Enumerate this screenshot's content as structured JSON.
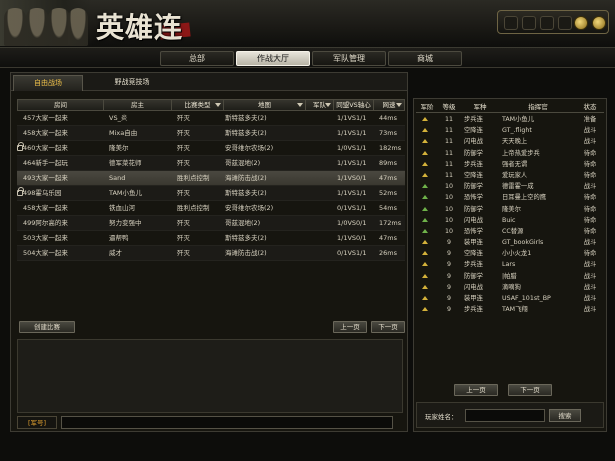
{
  "app": {
    "logo_text": "英雄连"
  },
  "nav": {
    "tabs": [
      {
        "label": "总部",
        "active": false
      },
      {
        "label": "作战大厅",
        "active": true
      },
      {
        "label": "军队管理",
        "active": false
      },
      {
        "label": "商城",
        "active": false
      }
    ]
  },
  "lobby": {
    "subtabs": [
      {
        "label": "自由战场",
        "active": true
      },
      {
        "label": "野战竞技场",
        "active": false
      }
    ],
    "columns": [
      "房间",
      "房主",
      "比赛类型",
      "地图",
      "军队",
      "同盟VS轴心",
      "网速"
    ],
    "rooms": [
      {
        "locked": false,
        "room": "457大家一起来",
        "host": "VS_炎",
        "type": "歼灭",
        "map": "斯特兹多夫(2)",
        "vs": "1/1VS1/1",
        "ping": "44ms"
      },
      {
        "locked": false,
        "room": "458大家一起来",
        "host": "Mixa自由",
        "type": "歼灭",
        "map": "斯特兹多夫(2)",
        "vs": "1/1VS1/1",
        "ping": "73ms"
      },
      {
        "locked": true,
        "room": "460大家一起来",
        "host": "隆美尔",
        "type": "歼灭",
        "map": "安哥维尔农场(2)",
        "vs": "1/0VS1/1",
        "ping": "182ms"
      },
      {
        "locked": false,
        "room": "464新手一起玩",
        "host": "德军菜花师",
        "type": "歼灭",
        "map": "哥兹混地(2)",
        "vs": "1/1VS1/1",
        "ping": "89ms"
      },
      {
        "locked": false,
        "room": "493大家一起来",
        "host": "Sand",
        "type": "胜利点控制",
        "map": "海滩防击战(2)",
        "vs": "1/1VS0/1",
        "ping": "47ms",
        "selected": true
      },
      {
        "locked": true,
        "room": "498霍乌乐园",
        "host": "TAM小鱼儿",
        "type": "歼灭",
        "map": "斯特兹多夫(2)",
        "vs": "1/1VS1/1",
        "ping": "52ms"
      },
      {
        "locked": false,
        "room": "458大家一起来",
        "host": "铁血山河",
        "type": "胜利点控制",
        "map": "安哥维尔农场(2)",
        "vs": "0/1VS1/1",
        "ping": "54ms"
      },
      {
        "locked": false,
        "room": "499阿尔高的来",
        "host": "努力变强中",
        "type": "歼灭",
        "map": "哥兹混地(2)",
        "vs": "1/0VS0/1",
        "ping": "172ms"
      },
      {
        "locked": false,
        "room": "503大家一起来",
        "host": "逼帮鸭",
        "type": "歼灭",
        "map": "斯特兹多夫(2)",
        "vs": "1/1VS0/1",
        "ping": "47ms"
      },
      {
        "locked": false,
        "room": "504大家一起来",
        "host": "威才",
        "type": "歼灭",
        "map": "海滩防击战(2)",
        "vs": "0/1VS1/1",
        "ping": "26ms"
      }
    ],
    "create_button": "创建比赛",
    "prev_button": "上一页",
    "next_button": "下一页",
    "chat_channel": "[军号]"
  },
  "players": {
    "columns": [
      "军阶",
      "等级",
      "军种",
      "指挥官",
      "状态"
    ],
    "rows": [
      {
        "rank": "gold",
        "level": "11",
        "branch": "步兵连",
        "name": "TAM小鱼儿",
        "status": "准备"
      },
      {
        "rank": "gold",
        "level": "11",
        "branch": "空降连",
        "name": "GT_.flight",
        "status": "战斗"
      },
      {
        "rank": "gold",
        "level": "11",
        "branch": "闪电战",
        "name": "天天晚上",
        "status": "战斗"
      },
      {
        "rank": "gold",
        "level": "11",
        "branch": "防御学",
        "name": "上帝热爱步兵",
        "status": "待命"
      },
      {
        "rank": "gold",
        "level": "11",
        "branch": "步兵连",
        "name": "强者无谓",
        "status": "待命"
      },
      {
        "rank": "gold",
        "level": "11",
        "branch": "空降连",
        "name": "爱玩家人",
        "status": "待命"
      },
      {
        "rank": "green",
        "level": "10",
        "branch": "防御学",
        "name": "德雷霍一成",
        "status": "战斗"
      },
      {
        "rank": "green",
        "level": "10",
        "branch": "恐怖学",
        "name": "日耳曼上空的鹰",
        "status": "待命"
      },
      {
        "rank": "green",
        "level": "10",
        "branch": "防御学",
        "name": "隆美尔",
        "status": "待命"
      },
      {
        "rank": "green",
        "level": "10",
        "branch": "闪电战",
        "name": "Buic",
        "status": "待命"
      },
      {
        "rank": "green",
        "level": "10",
        "branch": "恐怖学",
        "name": "CC替源",
        "status": "待命"
      },
      {
        "rank": "gold",
        "level": "9",
        "branch": "装甲连",
        "name": "GT_bookGirls",
        "status": "战斗"
      },
      {
        "rank": "gold",
        "level": "9",
        "branch": "空降连",
        "name": "小小火龙1",
        "status": "待命"
      },
      {
        "rank": "gold",
        "level": "9",
        "branch": "步兵连",
        "name": "Lars",
        "status": "战斗"
      },
      {
        "rank": "gold",
        "level": "9",
        "branch": "防御学",
        "name": "|帕腊",
        "status": "战斗"
      },
      {
        "rank": "gold",
        "level": "9",
        "branch": "闪电战",
        "name": "滴嘀狗",
        "status": "战斗"
      },
      {
        "rank": "gold",
        "level": "9",
        "branch": "装甲连",
        "name": "USAF_101st_BP",
        "status": "战斗"
      },
      {
        "rank": "gold",
        "level": "9",
        "branch": "步兵连",
        "name": "TAM飞翔",
        "status": "战斗"
      }
    ],
    "prev_button": "上一页",
    "next_button": "下一页",
    "search_label": "玩家姓名：",
    "search_button": "搜索"
  }
}
